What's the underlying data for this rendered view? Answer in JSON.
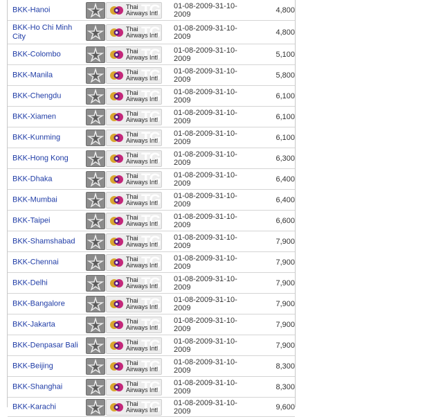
{
  "colors": {
    "link": "#1f3ca6",
    "row_border": "#d4d4d4",
    "star_alliance_bg": "#8b8b8b",
    "thai_purple": "#5c1a7a",
    "thai_gold": "#d9a62e",
    "thai_magenta": "#c3287a"
  },
  "icons": {
    "alliance": "star-alliance-icon",
    "airline": "thai-airways-logo-icon"
  },
  "fares": [
    {
      "route": "BKK-Hanoi",
      "airline": "Thai\nAirways Intl",
      "validity": "01-08-2009-31-10-2009",
      "price": "4,800"
    },
    {
      "route": "BKK-Ho Chi Minh City",
      "airline": "Thai\nAirways Intl",
      "validity": "01-08-2009-31-10-2009",
      "price": "4,800"
    },
    {
      "route": "BKK-Colombo",
      "airline": "Thai\nAirways Intl",
      "validity": "01-08-2009-31-10-2009",
      "price": "5,100"
    },
    {
      "route": "BKK-Manila",
      "airline": "Thai\nAirways Intl",
      "validity": "01-08-2009-31-10-2009",
      "price": "5,800"
    },
    {
      "route": "BKK-Chengdu",
      "airline": "Thai\nAirways Intl",
      "validity": "01-08-2009-31-10-2009",
      "price": "6,100"
    },
    {
      "route": "BKK-Xiamen",
      "airline": "Thai\nAirways Intl",
      "validity": "01-08-2009-31-10-2009",
      "price": "6,100"
    },
    {
      "route": "BKK-Kunming",
      "airline": "Thai\nAirways Intl",
      "validity": "01-08-2009-31-10-2009",
      "price": "6,100"
    },
    {
      "route": "BKK-Hong Kong",
      "airline": "Thai\nAirways Intl",
      "validity": "01-08-2009-31-10-2009",
      "price": "6,300"
    },
    {
      "route": "BKK-Dhaka",
      "airline": "Thai\nAirways Intl",
      "validity": "01-08-2009-31-10-2009",
      "price": "6,400"
    },
    {
      "route": "BKK-Mumbai",
      "airline": "Thai\nAirways Intl",
      "validity": "01-08-2009-31-10-2009",
      "price": "6,400"
    },
    {
      "route": "BKK-Taipei",
      "airline": "Thai\nAirways Intl",
      "validity": "01-08-2009-31-10-2009",
      "price": "6,600"
    },
    {
      "route": "BKK-Shamshabad",
      "airline": "Thai\nAirways Intl",
      "validity": "01-08-2009-31-10-2009",
      "price": "7,900"
    },
    {
      "route": "BKK-Chennai",
      "airline": "Thai\nAirways Intl",
      "validity": "01-08-2009-31-10-2009",
      "price": "7,900"
    },
    {
      "route": "BKK-Delhi",
      "airline": "Thai\nAirways Intl",
      "validity": "01-08-2009-31-10-2009",
      "price": "7,900"
    },
    {
      "route": "BKK-Bangalore",
      "airline": "Thai\nAirways Intl",
      "validity": "01-08-2009-31-10-2009",
      "price": "7,900"
    },
    {
      "route": "BKK-Jakarta",
      "airline": "Thai\nAirways Intl",
      "validity": "01-08-2009-31-10-2009",
      "price": "7,900"
    },
    {
      "route": "BKK-Denpasar Bali",
      "airline": "Thai\nAirways Intl",
      "validity": "01-08-2009-31-10-2009",
      "price": "7,900"
    },
    {
      "route": "BKK-Beijing",
      "airline": "Thai\nAirways Intl",
      "validity": "01-08-2009-31-10-2009",
      "price": "8,300"
    },
    {
      "route": "BKK-Shanghai",
      "airline": "Thai\nAirways Intl",
      "validity": "01-08-2009-31-10-2009",
      "price": "8,300"
    },
    {
      "route": "BKK-Karachi",
      "airline": "Thai\nAirways Intl",
      "validity": "01-08-2009-31-10-2009",
      "price": "9,600"
    }
  ]
}
